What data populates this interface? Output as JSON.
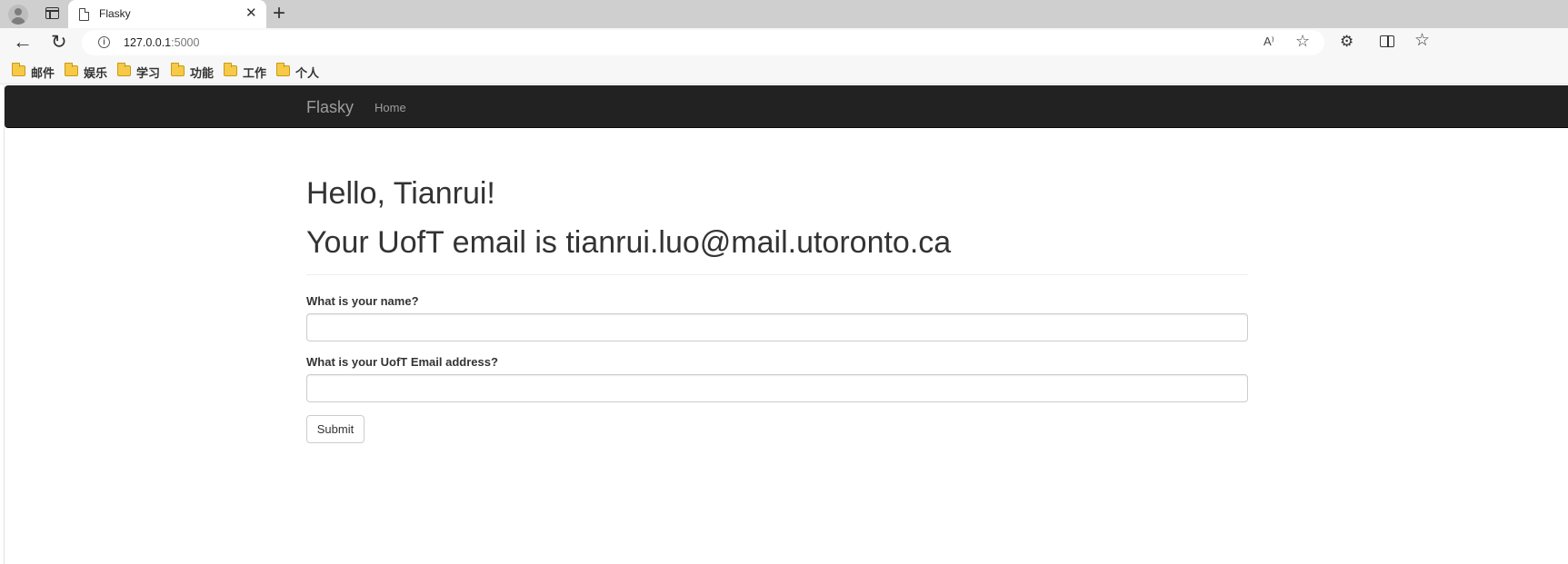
{
  "browser": {
    "tab_title": "Flasky",
    "tab_close": "✕",
    "new_tab": "+",
    "url_host": "127.0.0.1",
    "url_port": ":5000",
    "read_aloud": "A⁾",
    "bookmarks": [
      "邮件",
      "娱乐",
      "学习",
      "功能",
      "工作",
      "个人"
    ]
  },
  "navbar": {
    "brand": "Flasky",
    "home": "Home"
  },
  "main": {
    "greeting": "Hello, Tianrui!",
    "email_line": "Your UofT email is tianrui.luo@mail.utoronto.ca",
    "form": {
      "name_label": "What is your name?",
      "name_value": "",
      "email_label": "What is your UofT Email address?",
      "email_value": "",
      "submit_label": "Submit"
    }
  },
  "colors": {
    "navbar_bg": "#222222",
    "navbar_text": "#9d9d9d",
    "heading_text": "#333333"
  },
  "icons": [
    "profile-icon",
    "tab-actions-icon",
    "page-favicon",
    "close-icon",
    "plus-icon",
    "back-icon",
    "reload-icon",
    "info-icon",
    "read-aloud-icon",
    "favorite-star-icon",
    "extensions-icon",
    "split-screen-icon",
    "favorites-icon",
    "folder-icon"
  ]
}
